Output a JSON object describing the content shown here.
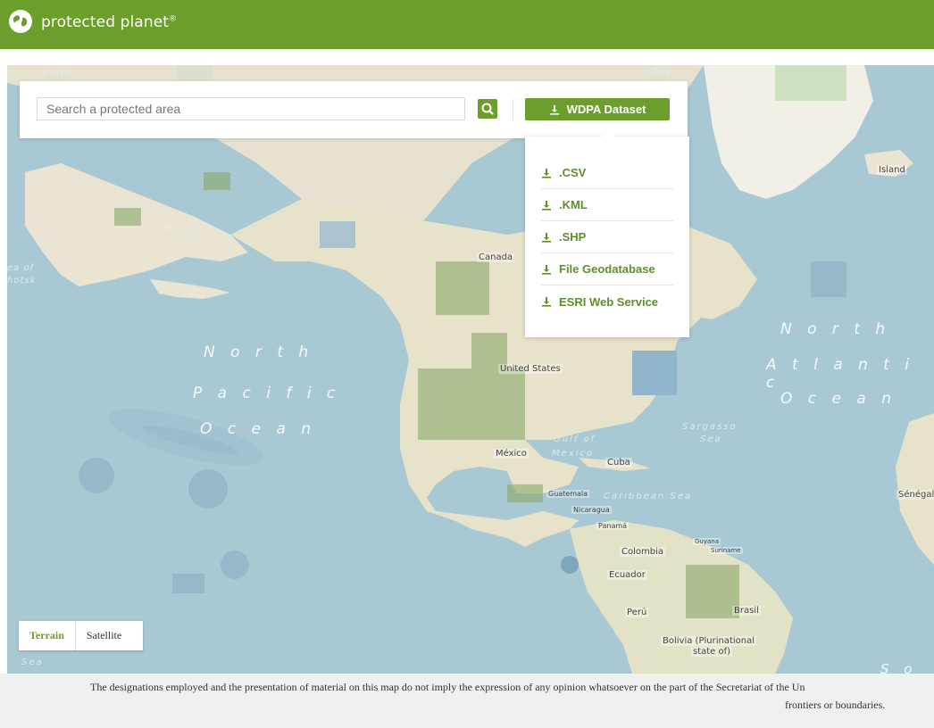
{
  "header": {
    "brand": "protected planet",
    "brand_mark": "®",
    "logo_icon": "globe-icon",
    "background_color": "#6b9e2a"
  },
  "search": {
    "placeholder": "Search a protected area",
    "button_icon": "search-icon"
  },
  "wdpa": {
    "label": "WDPA Dataset",
    "icon": "download-icon",
    "options": [
      ".CSV",
      ".KML",
      ".SHP",
      "File Geodatabase",
      "ESRI Web Service"
    ]
  },
  "map": {
    "ocean_labels": {
      "north_pacific": [
        "N o r t h",
        "P a c i f i c",
        "O c e a n"
      ],
      "north_atlantic": [
        "N o r t h",
        "A t l a n t i c",
        "O c e a n"
      ],
      "south": "S o u t"
    },
    "sea_labels": [
      "Bering",
      "Sea",
      "Gulf of",
      "Mexico",
      "Caribbean Sea",
      "Sargasso",
      "Sea",
      "Sea"
    ],
    "country_labels": [
      "Canada",
      "United States",
      "México",
      "Cuba",
      "Guatemala",
      "Nicaragua",
      "Panamá",
      "Colombia",
      "Ecuador",
      "Perú",
      "Brasil",
      "Bolivia (Plurinational",
      "state of)",
      "Island",
      "Sénégal",
      "Suriname",
      "Guyana"
    ],
    "edge_labels": [
      "ea of",
      "hotsk",
      "Berin",
      "Bay"
    ]
  },
  "map_type": {
    "terrain": "Terrain",
    "satellite": "Satellite",
    "active": "Terrain"
  },
  "disclaimer": {
    "line1": "The designations employed and the presentation of material on this map do not imply the expression of any opinion whatsoever on the part of the Secretariat of the Un",
    "line2": "frontiers or boundaries."
  }
}
